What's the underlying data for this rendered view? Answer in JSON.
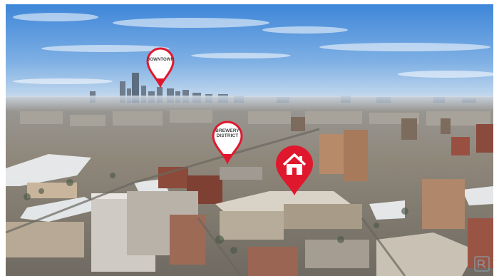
{
  "photo": {
    "sky_top": "#3e86d8",
    "sky_bottom": "#bcd6ee",
    "ground_color": "#8a8374",
    "snow_color": "#eef2f5"
  },
  "markers": [
    {
      "label_lines": [
        "DOWNTOWN"
      ],
      "fill": "#ffffff",
      "stroke": "#e0182d"
    },
    {
      "label_lines": [
        "BREWERY",
        "DISTRICT"
      ],
      "fill": "#ffffff",
      "stroke": "#e0182d"
    },
    {
      "icon": "house-icon",
      "fill": "#e0182d"
    }
  ],
  "watermark": {
    "icon": "realtor-logo-icon",
    "color": "#8a8f96"
  }
}
